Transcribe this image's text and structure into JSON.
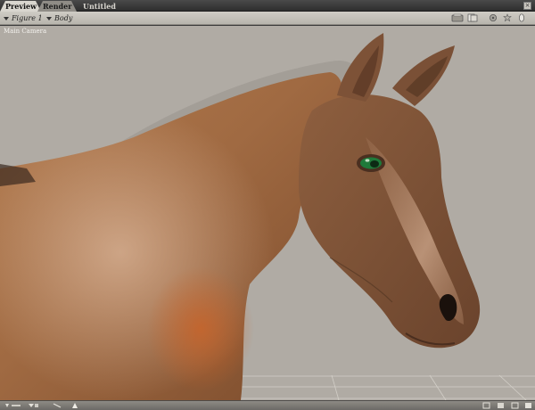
{
  "tabs": [
    {
      "label": "Preview",
      "active": true
    },
    {
      "label": "Render",
      "active": false
    }
  ],
  "document_title": "Untitled",
  "viewport": {
    "figure_selector": "Figure 1",
    "part_selector": "Body",
    "camera_label": "Main Camera"
  },
  "header_icons": [
    "display-style-icon",
    "document-icon",
    "gear-icon",
    "settings-icon",
    "orient-icon"
  ],
  "bottom_icons": [
    "playback-icon",
    "arrow-icon",
    "layout-icon",
    "light-icon",
    "grid-icon"
  ],
  "colors": {
    "viewport_bg": "#b0aba4",
    "horse_body": "#9c6842",
    "eye": "#1f7a3a",
    "floor_grid": "#d3cfc8"
  }
}
